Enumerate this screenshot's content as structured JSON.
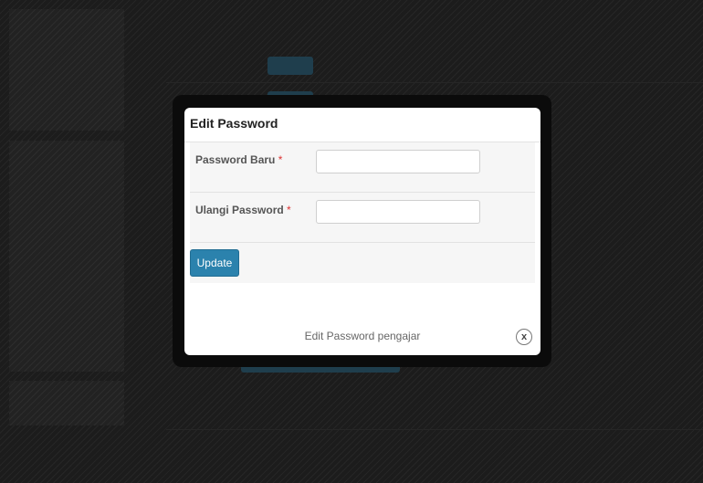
{
  "modal": {
    "title": "Edit Password",
    "fields": [
      {
        "label": "Password Baru",
        "required_mark": "*",
        "value": ""
      },
      {
        "label": "Ulangi Password",
        "required_mark": "*",
        "value": ""
      }
    ],
    "update_label": "Update",
    "footer_text": "Edit Password pengajar",
    "close_icon": "x"
  },
  "colors": {
    "primary_button": "#2b82ad",
    "required_mark": "#dd3333",
    "overlay": "#1c1c1c"
  }
}
